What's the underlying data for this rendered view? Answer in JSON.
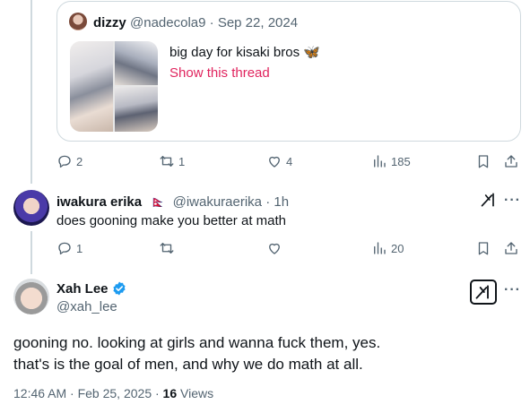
{
  "quoted_tweet": {
    "author_name": "dizzy",
    "author_handle": "@nadecola9",
    "separator": "·",
    "date": "Sep 22, 2024",
    "text": "big day for kisaki bros 🦋",
    "thread_link": "Show this thread",
    "photo_count": 3
  },
  "parent_actions": {
    "replies": "2",
    "reposts": "1",
    "likes": "4",
    "views": "185"
  },
  "reply_tweet": {
    "author_name": "iwakura erika",
    "flag": "🇳🇵",
    "author_handle": "@iwakuraerika",
    "separator": "·",
    "time": "1h",
    "text": "does gooning make you better at math"
  },
  "reply_actions": {
    "replies": "1",
    "reposts": "",
    "likes": "",
    "views": "20"
  },
  "main_tweet": {
    "author_name": "Xah Lee",
    "author_handle": "@xah_lee",
    "verified": true,
    "text_line1": "gooning no. looking at girls and wanna fuck them, yes.",
    "text_line2": "that's is the goal of men, and why we do math at all.",
    "timestamp": "12:46 AM · Feb 25, 2025 · ",
    "views_count": "16",
    "views_label": " Views"
  },
  "more_glyph": "···",
  "colors": {
    "text_primary": "#0f1419",
    "text_secondary": "#536471",
    "border": "#cfd9de",
    "link_pink": "#e0245e",
    "verified_blue": "#1d9bf0"
  },
  "icons": [
    "reply-icon",
    "repost-icon",
    "like-icon",
    "views-icon",
    "bookmark-icon",
    "share-icon",
    "grok-icon",
    "verified-badge-icon",
    "more-icon"
  ]
}
